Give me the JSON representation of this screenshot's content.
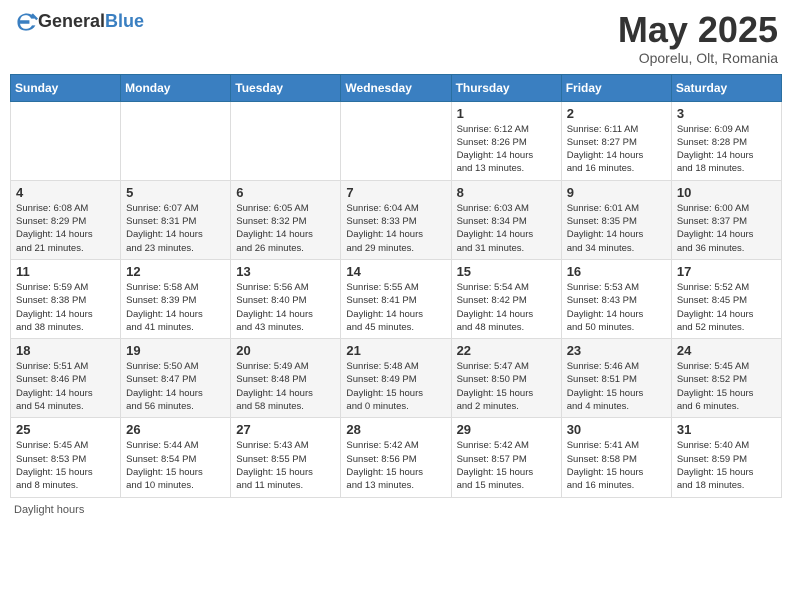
{
  "header": {
    "logo_general": "General",
    "logo_blue": "Blue",
    "title": "May 2025",
    "location": "Oporelu, Olt, Romania"
  },
  "days_of_week": [
    "Sunday",
    "Monday",
    "Tuesday",
    "Wednesday",
    "Thursday",
    "Friday",
    "Saturday"
  ],
  "footer": {
    "label": "Daylight hours"
  },
  "weeks": [
    [
      {
        "day": "",
        "info": ""
      },
      {
        "day": "",
        "info": ""
      },
      {
        "day": "",
        "info": ""
      },
      {
        "day": "",
        "info": ""
      },
      {
        "day": "1",
        "info": "Sunrise: 6:12 AM\nSunset: 8:26 PM\nDaylight: 14 hours\nand 13 minutes."
      },
      {
        "day": "2",
        "info": "Sunrise: 6:11 AM\nSunset: 8:27 PM\nDaylight: 14 hours\nand 16 minutes."
      },
      {
        "day": "3",
        "info": "Sunrise: 6:09 AM\nSunset: 8:28 PM\nDaylight: 14 hours\nand 18 minutes."
      }
    ],
    [
      {
        "day": "4",
        "info": "Sunrise: 6:08 AM\nSunset: 8:29 PM\nDaylight: 14 hours\nand 21 minutes."
      },
      {
        "day": "5",
        "info": "Sunrise: 6:07 AM\nSunset: 8:31 PM\nDaylight: 14 hours\nand 23 minutes."
      },
      {
        "day": "6",
        "info": "Sunrise: 6:05 AM\nSunset: 8:32 PM\nDaylight: 14 hours\nand 26 minutes."
      },
      {
        "day": "7",
        "info": "Sunrise: 6:04 AM\nSunset: 8:33 PM\nDaylight: 14 hours\nand 29 minutes."
      },
      {
        "day": "8",
        "info": "Sunrise: 6:03 AM\nSunset: 8:34 PM\nDaylight: 14 hours\nand 31 minutes."
      },
      {
        "day": "9",
        "info": "Sunrise: 6:01 AM\nSunset: 8:35 PM\nDaylight: 14 hours\nand 34 minutes."
      },
      {
        "day": "10",
        "info": "Sunrise: 6:00 AM\nSunset: 8:37 PM\nDaylight: 14 hours\nand 36 minutes."
      }
    ],
    [
      {
        "day": "11",
        "info": "Sunrise: 5:59 AM\nSunset: 8:38 PM\nDaylight: 14 hours\nand 38 minutes."
      },
      {
        "day": "12",
        "info": "Sunrise: 5:58 AM\nSunset: 8:39 PM\nDaylight: 14 hours\nand 41 minutes."
      },
      {
        "day": "13",
        "info": "Sunrise: 5:56 AM\nSunset: 8:40 PM\nDaylight: 14 hours\nand 43 minutes."
      },
      {
        "day": "14",
        "info": "Sunrise: 5:55 AM\nSunset: 8:41 PM\nDaylight: 14 hours\nand 45 minutes."
      },
      {
        "day": "15",
        "info": "Sunrise: 5:54 AM\nSunset: 8:42 PM\nDaylight: 14 hours\nand 48 minutes."
      },
      {
        "day": "16",
        "info": "Sunrise: 5:53 AM\nSunset: 8:43 PM\nDaylight: 14 hours\nand 50 minutes."
      },
      {
        "day": "17",
        "info": "Sunrise: 5:52 AM\nSunset: 8:45 PM\nDaylight: 14 hours\nand 52 minutes."
      }
    ],
    [
      {
        "day": "18",
        "info": "Sunrise: 5:51 AM\nSunset: 8:46 PM\nDaylight: 14 hours\nand 54 minutes."
      },
      {
        "day": "19",
        "info": "Sunrise: 5:50 AM\nSunset: 8:47 PM\nDaylight: 14 hours\nand 56 minutes."
      },
      {
        "day": "20",
        "info": "Sunrise: 5:49 AM\nSunset: 8:48 PM\nDaylight: 14 hours\nand 58 minutes."
      },
      {
        "day": "21",
        "info": "Sunrise: 5:48 AM\nSunset: 8:49 PM\nDaylight: 15 hours\nand 0 minutes."
      },
      {
        "day": "22",
        "info": "Sunrise: 5:47 AM\nSunset: 8:50 PM\nDaylight: 15 hours\nand 2 minutes."
      },
      {
        "day": "23",
        "info": "Sunrise: 5:46 AM\nSunset: 8:51 PM\nDaylight: 15 hours\nand 4 minutes."
      },
      {
        "day": "24",
        "info": "Sunrise: 5:45 AM\nSunset: 8:52 PM\nDaylight: 15 hours\nand 6 minutes."
      }
    ],
    [
      {
        "day": "25",
        "info": "Sunrise: 5:45 AM\nSunset: 8:53 PM\nDaylight: 15 hours\nand 8 minutes."
      },
      {
        "day": "26",
        "info": "Sunrise: 5:44 AM\nSunset: 8:54 PM\nDaylight: 15 hours\nand 10 minutes."
      },
      {
        "day": "27",
        "info": "Sunrise: 5:43 AM\nSunset: 8:55 PM\nDaylight: 15 hours\nand 11 minutes."
      },
      {
        "day": "28",
        "info": "Sunrise: 5:42 AM\nSunset: 8:56 PM\nDaylight: 15 hours\nand 13 minutes."
      },
      {
        "day": "29",
        "info": "Sunrise: 5:42 AM\nSunset: 8:57 PM\nDaylight: 15 hours\nand 15 minutes."
      },
      {
        "day": "30",
        "info": "Sunrise: 5:41 AM\nSunset: 8:58 PM\nDaylight: 15 hours\nand 16 minutes."
      },
      {
        "day": "31",
        "info": "Sunrise: 5:40 AM\nSunset: 8:59 PM\nDaylight: 15 hours\nand 18 minutes."
      }
    ]
  ]
}
